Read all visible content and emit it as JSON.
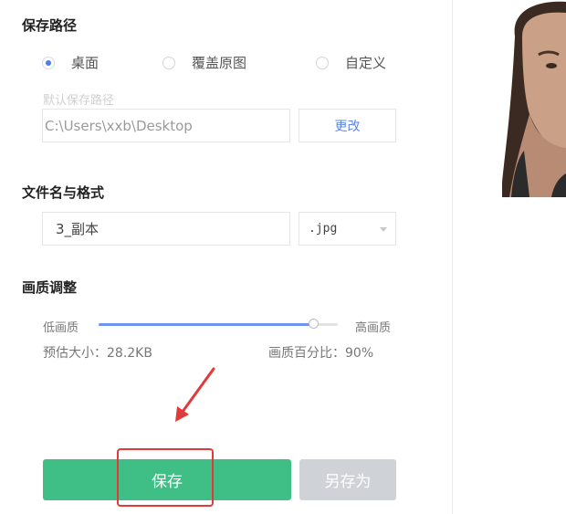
{
  "save_path": {
    "title": "保存路径",
    "options": [
      {
        "label": "桌面",
        "checked": true
      },
      {
        "label": "覆盖原图",
        "checked": false
      },
      {
        "label": "自定义",
        "checked": false
      }
    ],
    "default_hint": "默认保存路径",
    "path_value": "C:\\Users\\xxb\\Desktop",
    "change_label": "更改"
  },
  "file": {
    "title": "文件名与格式",
    "name_value": "3_副本",
    "format_value": ".jpg"
  },
  "quality": {
    "title": "画质调整",
    "low_label": "低画质",
    "high_label": "高画质",
    "level": 0.9,
    "estimate": "预估大小：28.2KB",
    "percent": "画质百分比：90%"
  },
  "actions": {
    "save_label": "保存",
    "save_as_label": "另存为"
  },
  "colors": {
    "accent": "#4d7bf3",
    "save": "#3fbf85",
    "disabled": "#cfd2d6",
    "annotation": "#e03a3a"
  },
  "preview": {
    "icon": "portrait-photo"
  }
}
